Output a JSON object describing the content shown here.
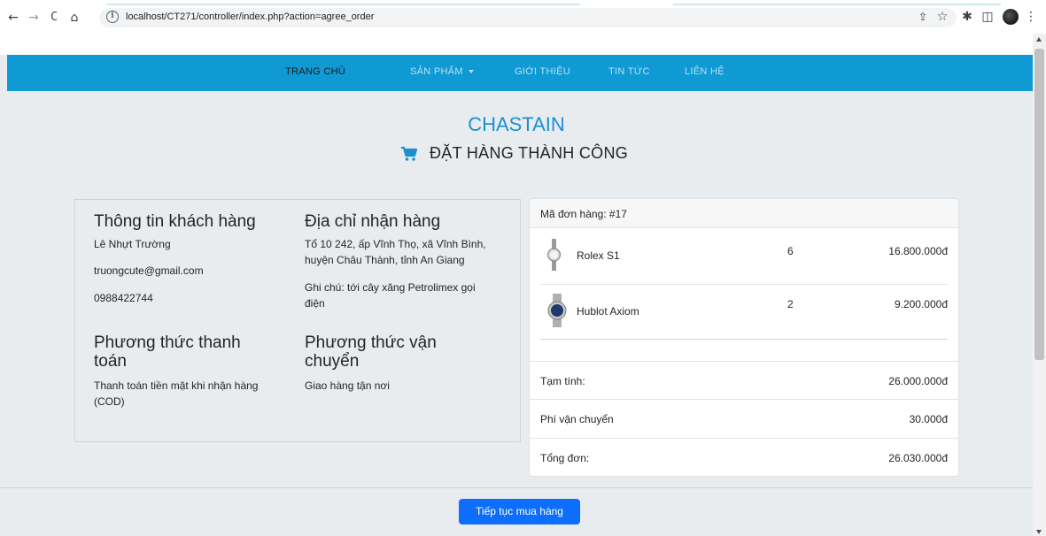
{
  "browser": {
    "url": "localhost/CT271/controller/index.php?action=agree_order",
    "back_icon": "←",
    "forward_icon": "→",
    "reload_icon": "C",
    "home_icon": "⌂",
    "share_icon": "⇪",
    "star_icon": "☆",
    "extension_icon": "✱",
    "sidepanel_icon": "◫",
    "menu_icon": "⋮"
  },
  "nav": {
    "items": [
      "TRANG CHỦ",
      "SẢN PHẨM",
      "GIỚI THIỆU",
      "TIN TỨC",
      "LIÊN HỆ"
    ],
    "active_color": "#1a1a1a",
    "bar_color": "#0f9ad4"
  },
  "brand": "CHASTAIN",
  "success_title": "ĐẶT HÀNG THÀNH CÔNG",
  "customer": {
    "heading": "Thông tin khách hàng",
    "name": "Lê Nhựt Trường",
    "email": "truongcute@gmail.com",
    "phone": "0988422744"
  },
  "address": {
    "heading": "Địa chỉ nhận hàng",
    "line1": "Tổ 10 242, ấp Vĩnh Thọ, xã Vĩnh Bình,",
    "line2": "huyện Châu Thành, tỉnh An Giang",
    "note1": "Ghi chú: tới cây xăng Petrolimex gọi",
    "note2": "điện"
  },
  "payment": {
    "heading1": "Phương thức thanh",
    "heading2": "toán",
    "value1": "Thanh toán tiền mặt khi nhận hàng",
    "value2": "(COD)"
  },
  "shipping": {
    "heading1": "Phương thức vận",
    "heading2": "chuyển",
    "value": "Giao hàng tận nơi"
  },
  "order": {
    "code": "Mã đơn hàng: #17",
    "items": [
      {
        "name": "Rolex S1",
        "qty": "6",
        "price": "16.800.000đ"
      },
      {
        "name": "Hublot Axiom",
        "qty": "2",
        "price": "9.200.000đ"
      }
    ],
    "subtotal_label": "Tạm tính:",
    "subtotal": "26.000.000đ",
    "shipping_label": "Phí vận chuyển",
    "shipping_fee": "30.000đ",
    "total_label": "Tổng đơn:",
    "total": "26.030.000đ"
  },
  "continue_button": "Tiếp tục mua hàng",
  "colors": {
    "brand": "#1c8fd1",
    "button": "#0d6efd"
  }
}
